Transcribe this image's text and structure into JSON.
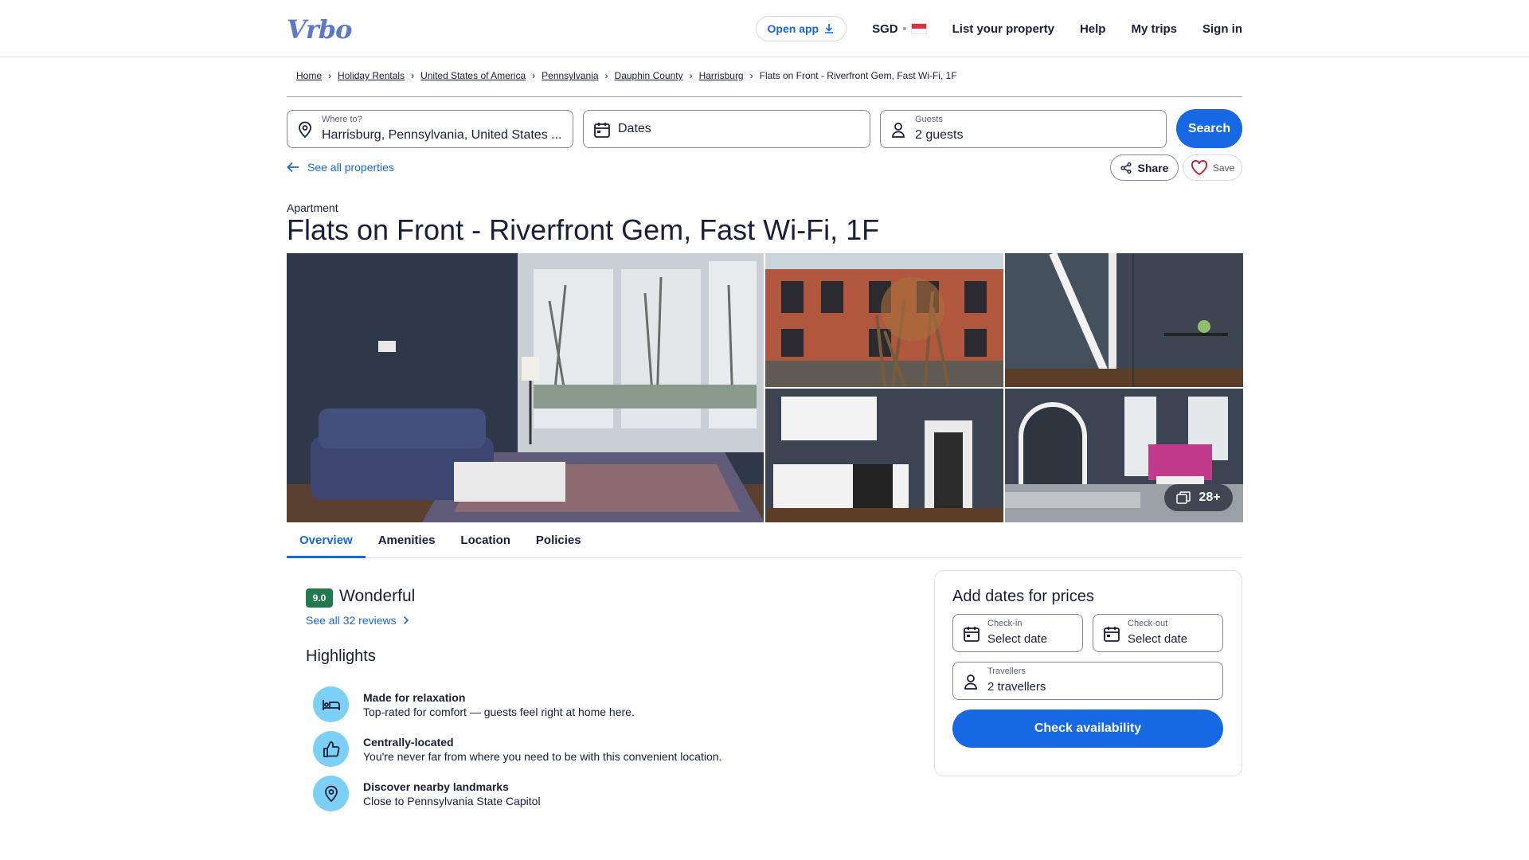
{
  "header": {
    "logo": "Vrbo",
    "open_app": "Open app",
    "currency": "SGD",
    "list_property": "List your property",
    "help": "Help",
    "my_trips": "My trips",
    "sign_in": "Sign in"
  },
  "breadcrumb": [
    "Home",
    "Holiday Rentals",
    "United States of America",
    "Pennsylvania",
    "Dauphin County",
    "Harrisburg",
    "Flats on Front - Riverfront Gem, Fast Wi-Fi, 1F"
  ],
  "search": {
    "destination_label": "Where to?",
    "destination_value": "Harrisburg, Pennsylvania, United States ...",
    "dates": "Dates",
    "guests_label": "Guests",
    "guests_value": "2 guests",
    "button": "Search"
  },
  "actions": {
    "see_all": "See all properties",
    "share": "Share",
    "save": "Save"
  },
  "property": {
    "type": "Apartment",
    "title": "Flats on Front - Riverfront Gem, Fast Wi-Fi, 1F",
    "photo_count": "28+"
  },
  "tabs": [
    "Overview",
    "Amenities",
    "Location",
    "Policies"
  ],
  "rating": {
    "score": "9.0",
    "word": "Wonderful",
    "reviews_link": "See all 32 reviews"
  },
  "highlights": {
    "heading": "Highlights",
    "items": [
      {
        "icon": "bed-icon",
        "title": "Made for relaxation",
        "text": "Top-rated for comfort — guests feel right at home here."
      },
      {
        "icon": "thumbs-up-icon",
        "title": "Centrally-located",
        "text": "You're never far from where you need to be with this convenient location."
      },
      {
        "icon": "map-pin-icon",
        "title": "Discover nearby landmarks",
        "text": "Close to Pennsylvania State Capitol"
      }
    ]
  },
  "booking": {
    "heading": "Add dates for prices",
    "checkin_label": "Check-in",
    "checkin_value": "Select date",
    "checkout_label": "Check-out",
    "checkout_value": "Select date",
    "travellers_label": "Travellers",
    "travellers_value": "2 travellers",
    "button": "Check availability"
  },
  "colors": {
    "brand_blue": "#1668e3",
    "rating_green": "#227950",
    "highlight_icon_bg": "#7ccff5"
  }
}
